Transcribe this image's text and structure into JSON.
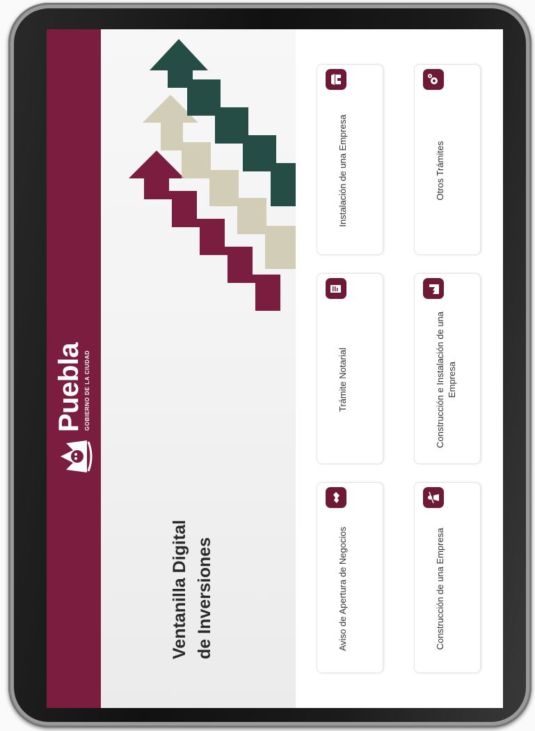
{
  "brand": {
    "name": "Puebla",
    "tagline": "GOBIERNO DE LA CIUDAD",
    "color": "#7a1d3e"
  },
  "hero": {
    "title_line1": "Ventanilla Digital",
    "title_line2": "de Inversiones"
  },
  "tramites": [
    {
      "label": "Aviso de Apertura de Negocios",
      "icon": "handshake-icon"
    },
    {
      "label": "Trámite Notarial",
      "icon": "document-icon"
    },
    {
      "label": "Instalación de una Empresa",
      "icon": "store-icon"
    },
    {
      "label": "Construcción de una Empresa",
      "icon": "worker-icon"
    },
    {
      "label": "Construcción e Instalación de una Empresa",
      "icon": "factory-icon"
    },
    {
      "label": "Otros Trámites",
      "icon": "gears-icon"
    }
  ]
}
